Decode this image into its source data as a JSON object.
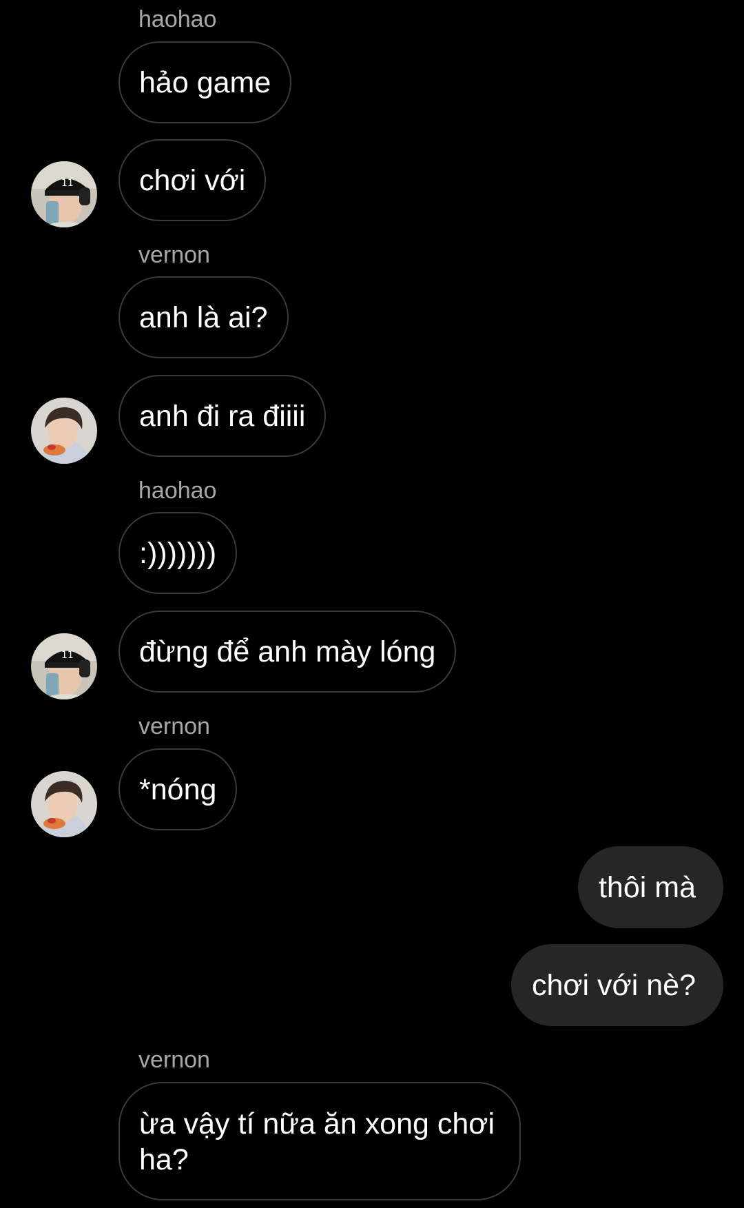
{
  "thread": {
    "items": [
      {
        "kind": "sender",
        "text": "haohao"
      },
      {
        "kind": "message",
        "text": "hảo game"
      },
      {
        "kind": "message",
        "text": "chơi với"
      },
      {
        "kind": "sender",
        "text": "vernon"
      },
      {
        "kind": "message",
        "text": "anh là ai?"
      },
      {
        "kind": "message",
        "text": "anh đi ra điiii"
      },
      {
        "kind": "sender",
        "text": "haohao"
      },
      {
        "kind": "message",
        "text": ":)))))))"
      },
      {
        "kind": "message",
        "text": "đừng để anh mày lóng"
      },
      {
        "kind": "sender",
        "text": "vernon"
      },
      {
        "kind": "message",
        "text": "*nóng"
      },
      {
        "kind": "message",
        "text": "thôi mà"
      },
      {
        "kind": "message",
        "text": "chơi với nè?"
      },
      {
        "kind": "sender",
        "text": "vernon"
      },
      {
        "kind": "message",
        "text": "ừa vậy tí nữa ăn xong chơi ha?"
      }
    ],
    "avatars": [
      {
        "user": "haohao",
        "icon": "avatar-photo-cap"
      },
      {
        "user": "vernon",
        "icon": "avatar-photo"
      },
      {
        "user": "haohao",
        "icon": "avatar-photo-cap"
      },
      {
        "user": "vernon",
        "icon": "avatar-photo"
      }
    ],
    "colors": {
      "background": "#000000",
      "incoming_border": "#3a3a3a",
      "outgoing_bubble": "#262626",
      "sender_name": "#a8a8a8",
      "text": "#ffffff"
    }
  }
}
